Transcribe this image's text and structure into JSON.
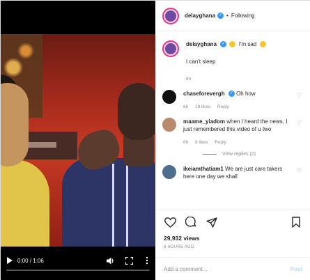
{
  "video": {
    "time": "0:00 / 1:06",
    "progress_fraction": 0.0,
    "icons": [
      "play-icon",
      "volume-icon",
      "fullscreen-icon",
      "more-icon"
    ]
  },
  "header": {
    "username": "delayghana",
    "separator": "•",
    "follow_label": "Following"
  },
  "caption": {
    "username": "delayghana",
    "text": "I'm sad",
    "line2": "I can't sleep",
    "time": "6h"
  },
  "comments": [
    {
      "username": "chaseforevergh",
      "text": "Oh how",
      "time": "6h",
      "likes": "18 likes",
      "reply": "Reply"
    },
    {
      "username": "maame_yiadom",
      "text": "when I heard the news, I just remembered this video of u two",
      "time": "6h",
      "likes": "8 likes",
      "reply": "Reply"
    },
    {
      "username": "ikeiamthatiam1",
      "text": "We are just care takers here one day we shall"
    }
  ],
  "view_replies": "View replies (2)",
  "stats": {
    "views": "29,932 views",
    "ago": "6 HOURS AGO"
  },
  "add_comment": {
    "placeholder": "Add a comment...",
    "post_label": "Post"
  },
  "colors": {
    "verified": "#3897f0",
    "post_disabled": "#b2dffc",
    "meta_gray": "#8e8e8e"
  }
}
